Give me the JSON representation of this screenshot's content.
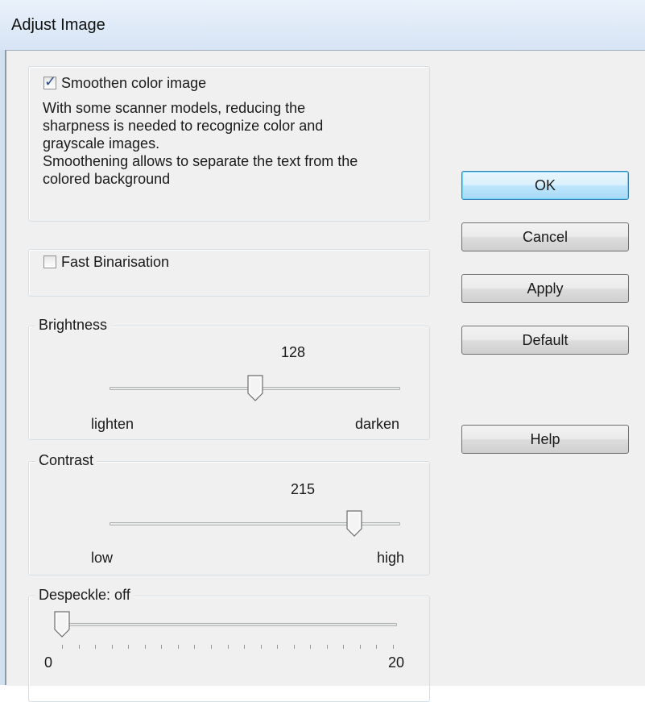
{
  "window": {
    "title": "Adjust Image"
  },
  "smoothen": {
    "checked": true,
    "label": "Smoothen color image",
    "description": [
      "With some scanner models, reducing the",
      "sharpness is needed to recognize color and",
      "grayscale images.",
      "Smoothening allows to separate the text from the",
      "colored background"
    ]
  },
  "fast_binarisation": {
    "checked": false,
    "label": "Fast Binarisation"
  },
  "brightness": {
    "legend": "Brightness",
    "value": "128",
    "min_label": "lighten",
    "max_label": "darken",
    "level": 0.5
  },
  "contrast": {
    "legend": "Contrast",
    "value": "215",
    "min_label": "low",
    "max_label": "high",
    "level": 0.84
  },
  "despeckle": {
    "legend": "Despeckle: off",
    "min_label": "0",
    "max_label": "20",
    "level": 0
  },
  "buttons": {
    "ok": "OK",
    "cancel": "Cancel",
    "apply": "Apply",
    "default": "Default",
    "help": "Help"
  }
}
